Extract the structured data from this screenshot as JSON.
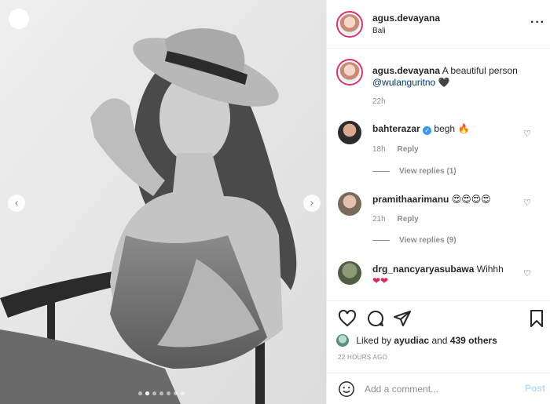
{
  "post": {
    "username": "agus.devayana",
    "location": "Bali"
  },
  "caption": {
    "username": "agus.devayana",
    "text": "A beautiful person",
    "mention": "@wulanguritno",
    "emoji": "🖤",
    "time": "22h"
  },
  "comments": [
    {
      "username": "bahterazar",
      "verified": true,
      "text": "begh",
      "emoji": "🔥",
      "time": "18h",
      "reply_label": "Reply",
      "view_replies": "View replies (1)"
    },
    {
      "username": "pramithaarimanu",
      "verified": false,
      "text": "",
      "emoji": "😍😍😍😍",
      "time": "21h",
      "reply_label": "Reply",
      "view_replies": "View replies (9)"
    },
    {
      "username": "drg_nancyaryasubawa",
      "verified": false,
      "text": "Wihhh",
      "emoji": "❤❤"
    }
  ],
  "likes": {
    "prefix": "Liked by",
    "user": "ayudiac",
    "suffix": "and",
    "others": "439 others"
  },
  "post_time": "22 HOURS AGO",
  "composer": {
    "placeholder": "Add a comment...",
    "post_label": "Post"
  },
  "icons": {
    "like": "heart-outline-icon",
    "comment": "speech-bubble-icon",
    "share": "paper-plane-icon",
    "save": "bookmark-icon",
    "emoji": "smiley-icon",
    "more": "three-dots-icon"
  },
  "colors": {
    "story_ring": "#e1306c",
    "link": "#00376b",
    "verified": "#3897f0",
    "post_button": "#b2dffc",
    "muted": "#8e8e8e"
  }
}
